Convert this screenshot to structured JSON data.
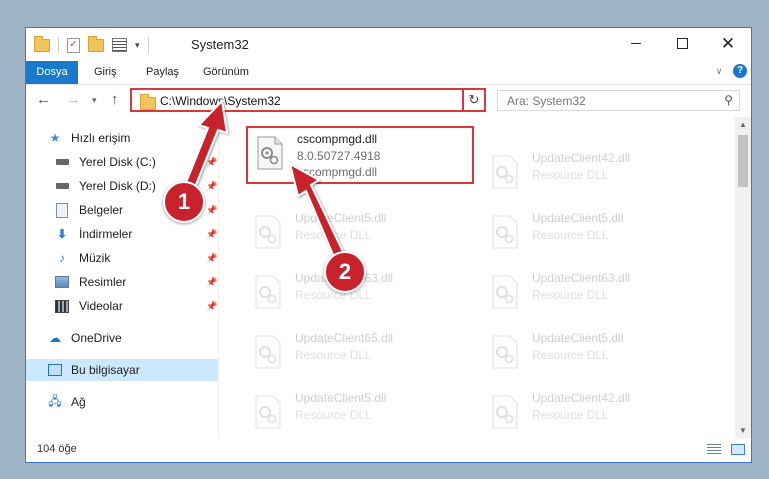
{
  "window": {
    "title": "System32",
    "accent": "#1979ca"
  },
  "qat": {
    "icons": [
      "folder-icon",
      "properties-check-icon",
      "new-folder-icon",
      "properties-icon",
      "customize-qat-icon"
    ]
  },
  "ribbon": {
    "tabs": [
      {
        "label": "Dosya",
        "active": true
      },
      {
        "label": "Giriş"
      },
      {
        "label": "Paylaş"
      },
      {
        "label": "Görünüm"
      }
    ]
  },
  "address": {
    "path": "C:\\Windows\\System32",
    "highlight_color": "#d9363e"
  },
  "search": {
    "placeholder": "Ara: System32"
  },
  "sidebar": {
    "items": [
      {
        "label": "Hızlı erişim",
        "icon": "star-icon",
        "pinned": false
      },
      {
        "label": "Yerel Disk (C:)",
        "icon": "drive-icon",
        "pinned": true
      },
      {
        "label": "Yerel Disk (D:)",
        "icon": "drive-icon",
        "pinned": true
      },
      {
        "label": "Belgeler",
        "icon": "documents-icon",
        "pinned": true
      },
      {
        "label": "İndirmeler",
        "icon": "downloads-icon",
        "pinned": true
      },
      {
        "label": "Müzik",
        "icon": "music-icon",
        "pinned": true
      },
      {
        "label": "Resimler",
        "icon": "pictures-icon",
        "pinned": true
      },
      {
        "label": "Videolar",
        "icon": "videos-icon",
        "pinned": true
      },
      {
        "label": "OneDrive",
        "icon": "onedrive-icon"
      },
      {
        "label": "Bu bilgisayar",
        "icon": "this-pc-icon",
        "selected": true
      },
      {
        "label": "Ağ",
        "icon": "network-icon"
      }
    ]
  },
  "files": {
    "highlighted": {
      "name": "cscompmgd.dll",
      "version": "8.0.50727.4918",
      "description": "cscompmgd.dll"
    },
    "left_column": [
      {
        "name": "UpdateClient5.dll",
        "type": "Resource DLL"
      },
      {
        "name": "UpdateClient63.dll",
        "type": "Resource DLL"
      },
      {
        "name": "UpdateClient65.dll",
        "type": "Resource DLL"
      },
      {
        "name": "UpdateClient5.dll",
        "type": "Resource DLL"
      }
    ],
    "right_column": [
      {
        "name": "UpdateClient42.dll",
        "type": "Resource DLL"
      },
      {
        "name": "UpdateClient5.dll",
        "type": "Resource DLL"
      },
      {
        "name": "UpdateClient63.dll",
        "type": "Resource DLL"
      },
      {
        "name": "UpdateClient5.dll",
        "type": "Resource DLL"
      },
      {
        "name": "UpdateClient42.dll",
        "type": "Resource DLL"
      }
    ]
  },
  "status": {
    "item_count": "104 öğe"
  },
  "annotations": [
    {
      "number": "1",
      "color": "#c8232c"
    },
    {
      "number": "2",
      "color": "#c8232c"
    }
  ]
}
